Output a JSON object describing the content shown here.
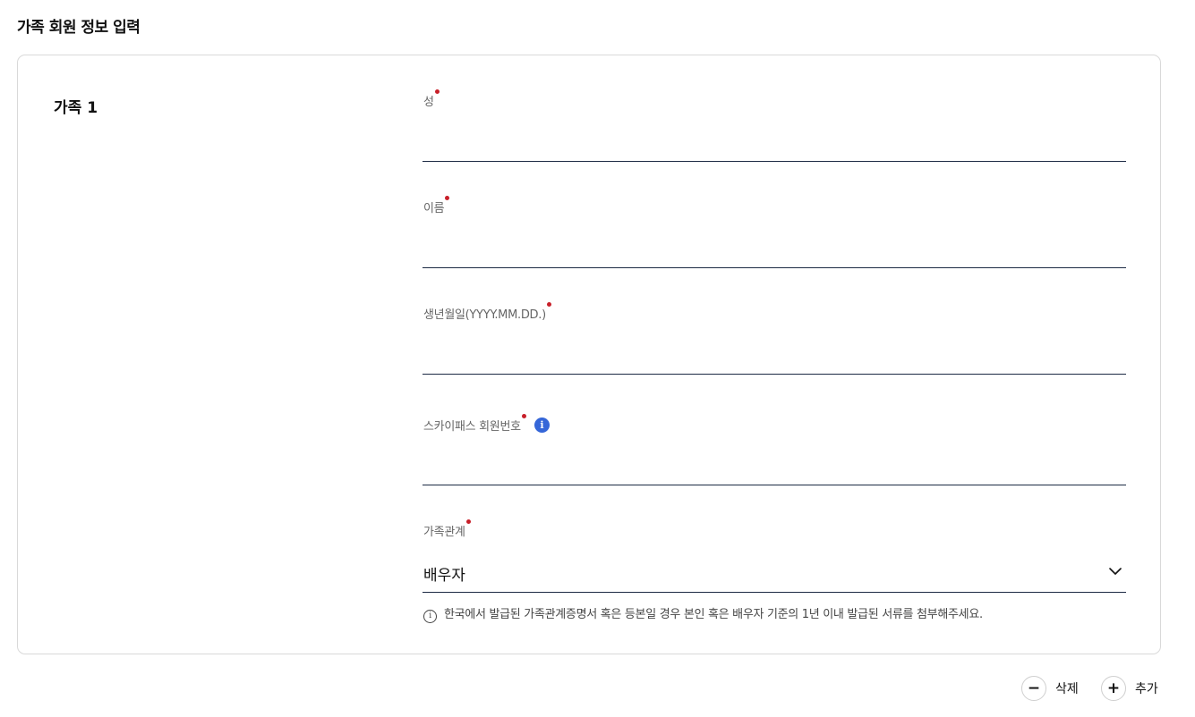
{
  "page": {
    "title": "가족 회원 정보 입력"
  },
  "member": {
    "title": "가족 1",
    "fields": {
      "last_name": {
        "label": "성",
        "value": ""
      },
      "first_name": {
        "label": "이름",
        "value": ""
      },
      "birthdate": {
        "label": "생년월일(YYYY.MM.DD.)",
        "value": ""
      },
      "member_number": {
        "label": "스카이패스 회원번호",
        "value": "",
        "info_icon": "i"
      },
      "relationship": {
        "label": "가족관계",
        "selected": "배우자"
      }
    },
    "notice": "한국에서 발급된 가족관계증명서 혹은 등본일 경우 본인 혹은 배우자 기준의 1년 이내 발급된 서류를 첨부해주세요."
  },
  "actions": {
    "delete": {
      "symbol": "−",
      "label": "삭제"
    },
    "add": {
      "symbol": "+",
      "label": "추가"
    }
  },
  "colors": {
    "required": "#c8202a",
    "info": "#3566d8",
    "underline": "#1c2a44"
  }
}
